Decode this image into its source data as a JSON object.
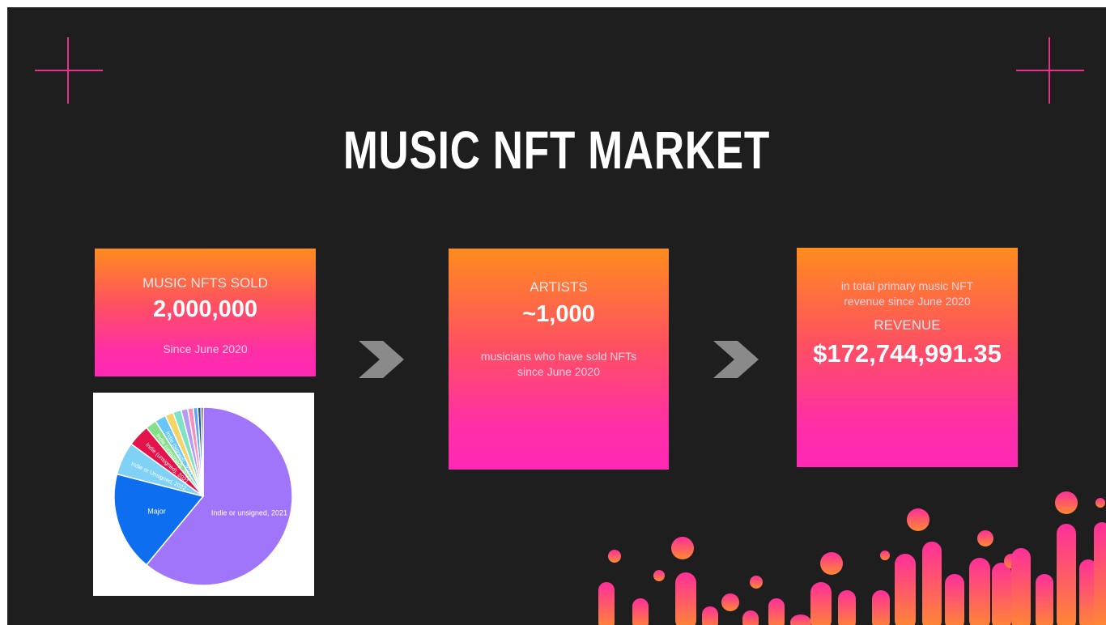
{
  "slide": {
    "title": "MUSIC NFT MARKET"
  },
  "cards": {
    "sold": {
      "label": "MUSIC NFTS SOLD",
      "value": "2,000,000",
      "note": "Since June 2020"
    },
    "artists": {
      "label": "ARTISTS",
      "value": "~1,000",
      "note": "musicians who have sold NFTs since June 2020"
    },
    "revenue": {
      "intro": "in total primary music NFT revenue since June 2020",
      "label": "REVENUE",
      "value": "$172,744,991.35"
    }
  },
  "chart_data": {
    "type": "pie",
    "slices": [
      {
        "label": "Indie or unsigned, 2021",
        "value": 61,
        "color": "#a175fa"
      },
      {
        "label": "Major",
        "value": 18,
        "color": "#0d6ff0"
      },
      {
        "label": "Indie or Unsigned, 2022",
        "value": 6,
        "color": "#7fd1f5"
      },
      {
        "label": "Indie (unsigned), 2021",
        "value": 4,
        "color": "#e5134b"
      },
      {
        "label": "Indie (unsigned), 2022",
        "value": 2,
        "color": "#86e08a"
      },
      {
        "label": "Indie (signed), 2021",
        "value": 2,
        "color": "#67c6f5"
      },
      {
        "label": "",
        "value": 1.5,
        "color": "#f6d365"
      },
      {
        "label": "",
        "value": 1.5,
        "color": "#7de3c4"
      },
      {
        "label": "",
        "value": 1.2,
        "color": "#b49cf5"
      },
      {
        "label": "",
        "value": 1,
        "color": "#f38ec0"
      },
      {
        "label": "",
        "value": 0.8,
        "color": "#5da6f2"
      },
      {
        "label": "",
        "value": 0.6,
        "color": "#1e4db5"
      },
      {
        "label": "",
        "value": 0.4,
        "color": "#333333"
      }
    ]
  },
  "colors": {
    "background": "#1f1e1f",
    "accent_pink": "#e8318a",
    "gradient_top": "#ff8c1d",
    "gradient_bottom": "#ff28b5",
    "arrow": "#8a8a8a"
  },
  "icons": {
    "corner": "crosshair-icon",
    "flow": "chevron-right-icon",
    "decoration": "equalizer-bars-icon"
  }
}
